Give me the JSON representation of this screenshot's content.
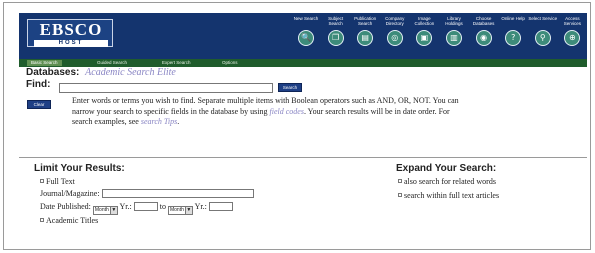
{
  "header": {
    "logo": {
      "main": "EBSCO",
      "sub": "HOST"
    },
    "toolbar": [
      {
        "label": "New Search",
        "icon": "search-icon",
        "glyph": "🔍"
      },
      {
        "label": "Subject Search",
        "icon": "subject-icon",
        "glyph": "❐"
      },
      {
        "label": "Publication Search",
        "icon": "publication-icon",
        "glyph": "▤"
      },
      {
        "label": "Company Directory",
        "icon": "company-icon",
        "glyph": "◎"
      },
      {
        "label": "Image Collection",
        "icon": "image-icon",
        "glyph": "▣"
      },
      {
        "label": "Library Holdings",
        "icon": "library-icon",
        "glyph": "▥"
      },
      {
        "label": "Choose Databases",
        "icon": "databases-icon",
        "glyph": "◉"
      },
      {
        "label": "Online Help",
        "icon": "help-icon",
        "glyph": "?"
      },
      {
        "label": "Select Service",
        "icon": "service-icon",
        "glyph": "⚲"
      },
      {
        "label": "Access Services",
        "icon": "access-icon",
        "glyph": "⊕"
      }
    ],
    "tabs": [
      {
        "label": "Basic Search",
        "active": true
      },
      {
        "label": "Guided Search",
        "active": false
      },
      {
        "label": "Expert Search",
        "active": false
      },
      {
        "label": "Options",
        "active": false
      }
    ]
  },
  "search": {
    "databases_label": "Databases:",
    "databases_value": "Academic Search Elite",
    "find_label": "Find:",
    "find_value": "",
    "search_button": "Search",
    "clear_button": "Clear",
    "help_before_link": "Enter words or terms you wish to find. Separate multiple items with Boolean operators such as AND, OR, NOT. You can narrow your search to specific fields in the database by using",
    "help_link_1": "field codes",
    "help_middle": ". Your search results will be in date order. For search examples, see",
    "help_link_2": "search Tips",
    "help_end": "."
  },
  "limit": {
    "title": "Limit Your Results:",
    "full_text": "Full Text",
    "journal_label": "Journal/Magazine:",
    "journal_value": "",
    "date_label": "Date Published:",
    "month_from": "Month",
    "yr_label_from": "Yr.:",
    "to_label": "to",
    "month_to": "Month",
    "yr_label_to": "Yr.:",
    "academic_titles": "Academic Titles"
  },
  "expand": {
    "title": "Expand Your Search:",
    "related_words": "also search for related words",
    "full_text_articles": "search within full text articles"
  }
}
